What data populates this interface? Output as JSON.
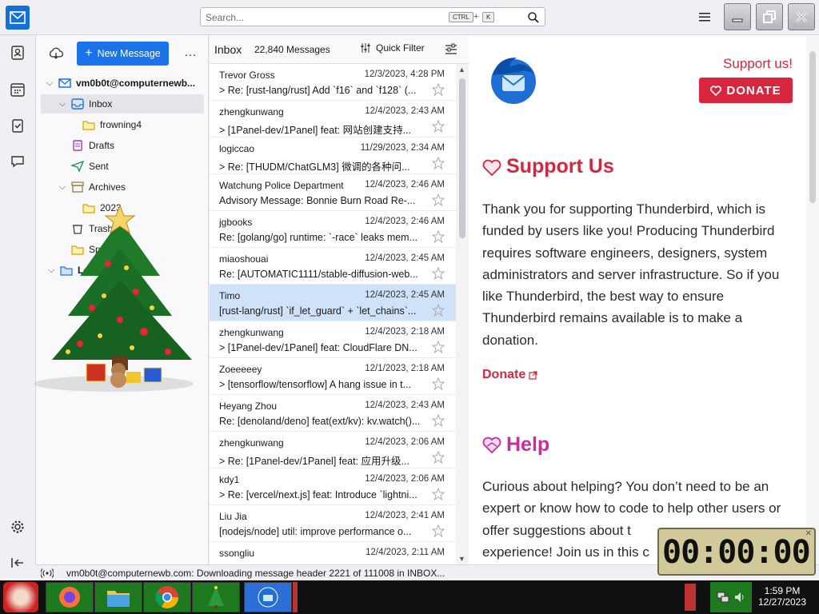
{
  "app": {
    "icon": "thunderbird-mail-icon"
  },
  "titlebar": {
    "search_placeholder": "Search...",
    "kbd_ctrl": "CTRL",
    "kbd_plus": "+",
    "kbd_k": "K"
  },
  "folders": {
    "new_message": "New Message",
    "more": "…",
    "account": "vm0b0t@computernewb...",
    "items": [
      {
        "label": "Inbox",
        "icon": "inbox-icon"
      },
      {
        "label": "frowning4",
        "icon": "folder-icon"
      },
      {
        "label": "Drafts",
        "icon": "drafts-icon"
      },
      {
        "label": "Sent",
        "icon": "sent-icon"
      },
      {
        "label": "Archives",
        "icon": "archive-icon"
      },
      {
        "label": "2023",
        "icon": "folder-icon"
      },
      {
        "label": "Trash",
        "icon": "trash-icon"
      },
      {
        "label": "Spa",
        "icon": "folder-icon"
      },
      {
        "label": "Loca",
        "icon": "local-folders-icon"
      }
    ]
  },
  "list": {
    "folder_name": "Inbox",
    "count": "22,840 Messages",
    "quick_filter": "Quick Filter",
    "messages": [
      {
        "from": "Trevor Gross",
        "date": "12/3/2023, 4:28 PM",
        "subject": "Re: [rust-lang/rust] Add `f16` and `f128` (...",
        "thread": true
      },
      {
        "from": "zhengkunwang",
        "date": "12/4/2023, 2:43 AM",
        "subject": "[1Panel-dev/1Panel] feat: 网站创建支持...",
        "thread": true
      },
      {
        "from": "logiccao",
        "date": "11/29/2023, 2:34 AM",
        "subject": "Re: [THUDM/ChatGLM3] 微调的各种问...",
        "thread": true
      },
      {
        "from": "Watchung Police Department",
        "date": "12/4/2023, 2:46 AM",
        "subject": "Advisory Message: Bonnie Burn Road Re-...",
        "thread": false
      },
      {
        "from": "jgbooks",
        "date": "12/4/2023, 2:46 AM",
        "subject": "Re: [golang/go] runtime: `-race` leaks mem...",
        "thread": false
      },
      {
        "from": "miaoshouai",
        "date": "12/4/2023, 2:45 AM",
        "subject": "Re: [AUTOMATIC1111/stable-diffusion-web...",
        "thread": false
      },
      {
        "from": "Timo",
        "date": "12/4/2023, 2:45 AM",
        "subject": "[rust-lang/rust] `if_let_guard` + `let_chains`...",
        "thread": false
      },
      {
        "from": "zhengkunwang",
        "date": "12/4/2023, 2:18 AM",
        "subject": "[1Panel-dev/1Panel] feat: CloudFlare DN...",
        "thread": true
      },
      {
        "from": "Zoeeeeey",
        "date": "12/1/2023, 2:18 AM",
        "subject": "[tensorflow/tensorflow] A hang issue in t...",
        "thread": true
      },
      {
        "from": "Heyang Zhou",
        "date": "12/4/2023, 2:43 AM",
        "subject": "Re: [denoland/deno] feat(ext/kv): kv.watch()...",
        "thread": false
      },
      {
        "from": "zhengkunwang",
        "date": "12/4/2023, 2:06 AM",
        "subject": "Re: [1Panel-dev/1Panel] feat: 应用升级...",
        "thread": true
      },
      {
        "from": "kdy1",
        "date": "12/4/2023, 2:06 AM",
        "subject": "Re: [vercel/next.js] feat: Introduce `lightni...",
        "thread": true
      },
      {
        "from": "Liu Jia",
        "date": "12/4/2023, 2:41 AM",
        "subject": "[nodejs/node] util: improve performance o...",
        "thread": false
      },
      {
        "from": "ssongliu",
        "date": "12/4/2023, 2:11 AM",
        "subject": "",
        "thread": false
      }
    ]
  },
  "reader": {
    "support_us_link": "Support us!",
    "donate_button": "DONATE",
    "heading_support": "Support Us",
    "para_support": "Thank you for supporting Thunderbird, which is funded by users like you! Producing Thunderbird requires software engineers, designers, system administrators and server infrastructure. So if you like Thunderbird, the best way to ensure Thunderbird remains available is to make a donation.",
    "donate_link": "Donate",
    "heading_help": "Help",
    "para_help": "Curious about helping? You don’t need to be an expert or know how to code to help other users or offer suggestions about t",
    "para_help_last": "experience! Join us in this c"
  },
  "status": {
    "text": "vm0b0t@computernewb.com: Downloading message header 2221 of 111008 in INBOX..."
  },
  "timer": {
    "digits": "00:00:00"
  },
  "taskbar": {
    "time": "1:59 PM",
    "date": "12/27/2023"
  },
  "colors": {
    "accent": "#1a73e8",
    "donate_red": "#d7263d",
    "help_purple": "#c42f9d",
    "selected_row": "#cfe2f8"
  }
}
